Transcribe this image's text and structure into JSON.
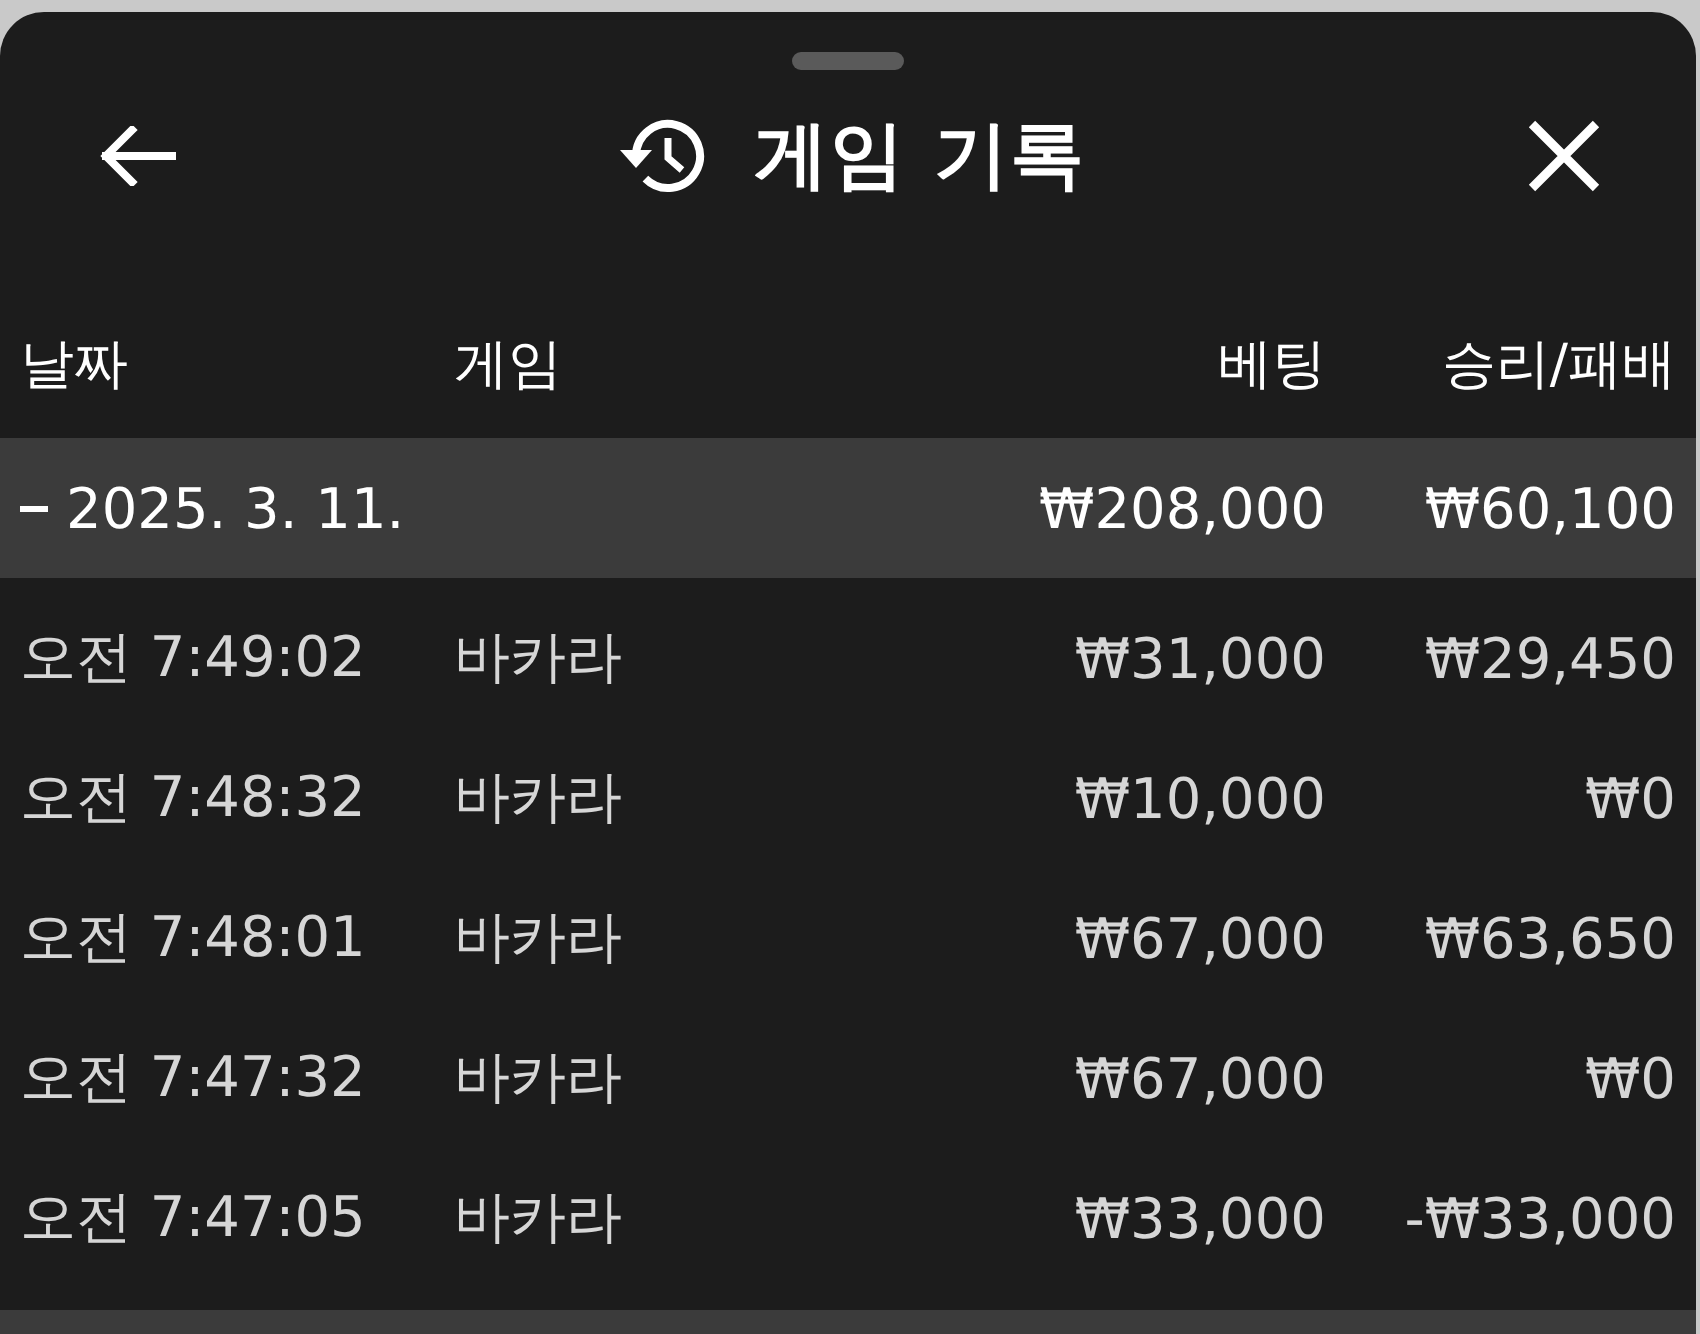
{
  "sheet": {
    "title": "게임 기록"
  },
  "table": {
    "columns": [
      "날짜",
      "게임",
      "베팅",
      "승리/패배"
    ],
    "groups": [
      {
        "date": "2025. 3. 11.",
        "expanded": true,
        "bet": "₩208,000",
        "result": "₩60,100",
        "rows": [
          {
            "time": "오전 7:49:02",
            "game": "바카라",
            "bet": "₩31,000",
            "result": "₩29,450"
          },
          {
            "time": "오전 7:48:32",
            "game": "바카라",
            "bet": "₩10,000",
            "result": "₩0"
          },
          {
            "time": "오전 7:48:01",
            "game": "바카라",
            "bet": "₩67,000",
            "result": "₩63,650"
          },
          {
            "time": "오전 7:47:32",
            "game": "바카라",
            "bet": "₩67,000",
            "result": "₩0"
          },
          {
            "time": "오전 7:47:05",
            "game": "바카라",
            "bet": "₩33,000",
            "result": "-₩33,000"
          }
        ]
      }
    ]
  }
}
